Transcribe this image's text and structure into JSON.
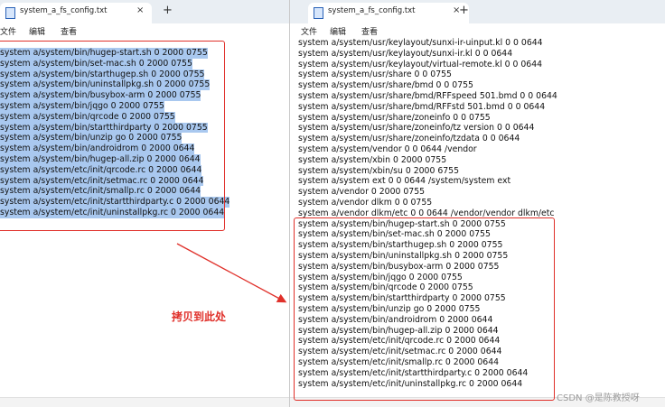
{
  "left_window": {
    "tab_title": "system_a_fs_config.txt",
    "tab_close": "×",
    "tab_add": "+",
    "menu": [
      "文件",
      "编辑",
      "查看"
    ],
    "lines": [
      "system a/system/bin/hugep-start.sh 0 2000 0755",
      "system a/system/bin/set-mac.sh 0 2000 0755",
      "system a/system/bin/starthugep.sh 0 2000 0755",
      "system a/system/bin/uninstallpkg.sh 0 2000 0755",
      "system a/system/bin/busybox-arm 0 2000 0755",
      "system a/system/bin/jqgo 0 2000 0755",
      "system a/system/bin/qrcode 0 2000 0755",
      "system a/system/bin/startthirdparty 0 2000 0755",
      "system a/system/bin/unzip go 0 2000 0755",
      "system a/system/bin/androidrom 0 2000 0644",
      "system a/system/bin/hugep-all.zip 0 2000 0644",
      "system a/system/etc/init/qrcode.rc 0 2000 0644",
      "system a/system/etc/init/setmac.rc 0 2000 0644",
      "system a/system/etc/init/smallp.rc 0 2000 0644",
      "system a/system/etc/init/startthirdparty.c 0 2000 0644",
      "system a/system/etc/init/uninstallpkg.rc 0 2000 0644"
    ]
  },
  "right_window": {
    "tab_title": "system_a_fs_config.txt",
    "tab_close": "×",
    "tab_add": "+",
    "menu": [
      "文件",
      "编辑",
      "查看"
    ],
    "lines": [
      "system a/system/usr/keylayout/sunxi-ir-uinput.kl 0 0 0644",
      "system a/system/usr/keylayout/sunxi-ir.kl 0 0 0644",
      "system a/system/usr/keylayout/virtual-remote.kl 0 0 0644",
      "system a/system/usr/share 0 0 0755",
      "system a/system/usr/share/bmd 0 0 0755",
      "system a/system/usr/share/bmd/RFFspeed 501.bmd 0 0 0644",
      "system a/system/usr/share/bmd/RFFstd 501.bmd 0 0 0644",
      "system a/system/usr/share/zoneinfo 0 0 0755",
      "system a/system/usr/share/zoneinfo/tz version 0 0 0644",
      "system a/system/usr/share/zoneinfo/tzdata 0 0 0644",
      "system a/system/vendor 0 0 0644 /vendor",
      "system a/system/xbin 0 2000 0755",
      "system a/system/xbin/su 0 2000 6755",
      "system a/system ext 0 0 0644 /system/system ext",
      "system a/vendor 0 2000 0755",
      "system a/vendor dlkm 0 0 0755",
      "system a/vendor dlkm/etc 0 0 0644 /vendor/vendor dlkm/etc",
      "system a/system/bin/hugep-start.sh 0 2000 0755",
      "system a/system/bin/set-mac.sh 0 2000 0755",
      "system a/system/bin/starthugep.sh 0 2000 0755",
      "system a/system/bin/uninstallpkg.sh 0 2000 0755",
      "system a/system/bin/busybox-arm 0 2000 0755",
      "system a/system/bin/jqgo 0 2000 0755",
      "system a/system/bin/qrcode 0 2000 0755",
      "system a/system/bin/startthirdparty 0 2000 0755",
      "system a/system/bin/unzip go 0 2000 0755",
      "system a/system/bin/androidrom 0 2000 0644",
      "system a/system/bin/hugep-all.zip 0 2000 0644",
      "system a/system/etc/init/qrcode.rc 0 2000 0644",
      "system a/system/etc/init/setmac.rc 0 2000 0644",
      "system a/system/etc/init/smallp.rc 0 2000 0644",
      "system a/system/etc/init/startthirdparty.c 0 2000 0644",
      "system a/system/etc/init/uninstallpkg.rc 0 2000 0644"
    ]
  },
  "annotation": {
    "text": "拷贝到此处",
    "color": "#e0302a"
  },
  "watermark": "CSDN @是陈教授呀",
  "colors": {
    "selection": "#a9c8ef",
    "highlight_box": "#e0302a",
    "tab_bar": "#e9eef3"
  }
}
